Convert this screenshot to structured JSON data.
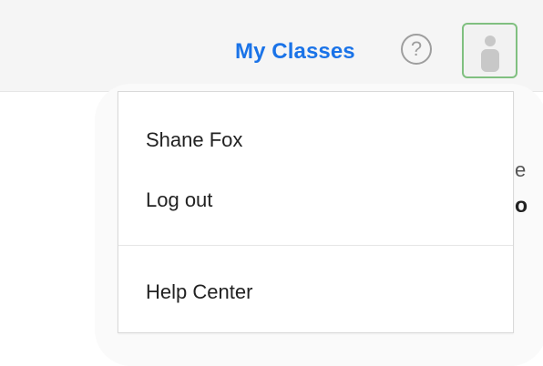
{
  "header": {
    "nav_link": "My Classes",
    "help_glyph": "?",
    "help_icon": "question-circle-icon",
    "avatar_icon": "user-silhouette-icon",
    "accent_color": "#1a73e8",
    "avatar_border_color": "#80c080"
  },
  "background": {
    "text_1": "e",
    "text_2": "o"
  },
  "dropdown": {
    "user_name": "Shane Fox",
    "logout_label": "Log out",
    "help_center_label": "Help Center"
  }
}
